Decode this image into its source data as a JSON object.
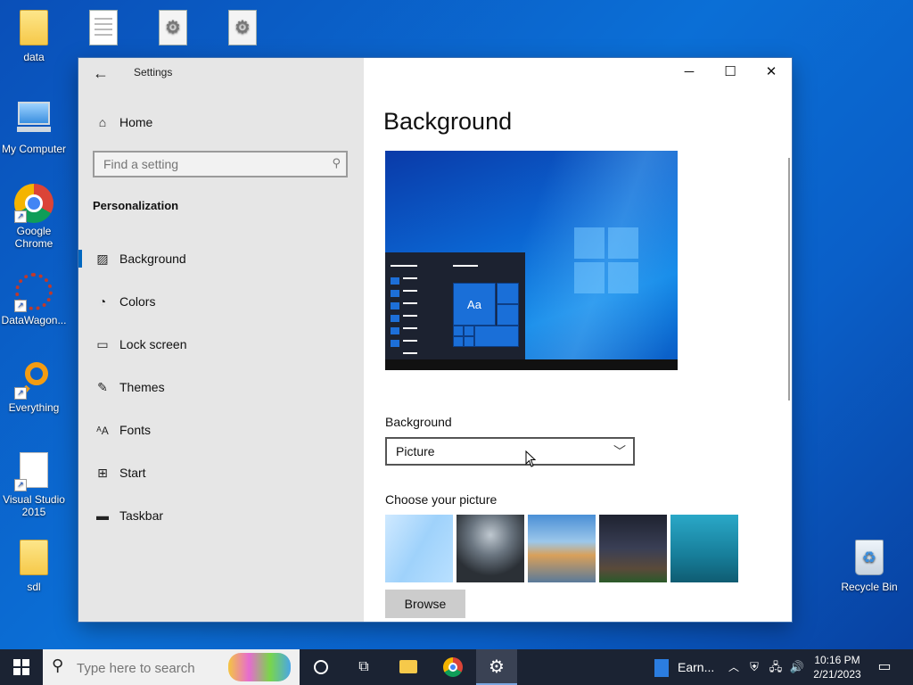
{
  "desktop": {
    "icons": [
      {
        "label": "data"
      },
      {
        "label": ""
      },
      {
        "label": ""
      },
      {
        "label": ""
      },
      {
        "label": "My Computer"
      },
      {
        "label": "Google Chrome"
      },
      {
        "label": "DataWagon..."
      },
      {
        "label": "Everything"
      },
      {
        "label": "Visual Studio 2015"
      },
      {
        "label": "sdl"
      },
      {
        "label": "Recycle Bin"
      }
    ]
  },
  "window": {
    "title": "Settings",
    "controls": {
      "minimize": "─",
      "maximize": "☐",
      "close": "✕"
    }
  },
  "sidebar": {
    "home_label": "Home",
    "search_placeholder": "Find a setting",
    "section_title": "Personalization",
    "items": [
      {
        "label": "Background",
        "icon": "picture-icon",
        "active": true
      },
      {
        "label": "Colors",
        "icon": "palette-icon",
        "active": false
      },
      {
        "label": "Lock screen",
        "icon": "lock-screen-icon",
        "active": false
      },
      {
        "label": "Themes",
        "icon": "brush-icon",
        "active": false
      },
      {
        "label": "Fonts",
        "icon": "font-icon",
        "active": false
      },
      {
        "label": "Start",
        "icon": "start-icon",
        "active": false
      },
      {
        "label": "Taskbar",
        "icon": "taskbar-icon",
        "active": false
      }
    ]
  },
  "content": {
    "page_title": "Background",
    "preview_tile_text": "Aa",
    "background_label": "Background",
    "background_value": "Picture",
    "choose_label": "Choose your picture",
    "browse_label": "Browse"
  },
  "taskbar": {
    "search_placeholder": "Type here to search",
    "app_label": "Earn...",
    "time": "10:16 PM",
    "date": "2/21/2023"
  },
  "colors": {
    "accent": "#0067c0",
    "taskbar": "#1b2333",
    "sidebar": "#e6e6e6"
  }
}
